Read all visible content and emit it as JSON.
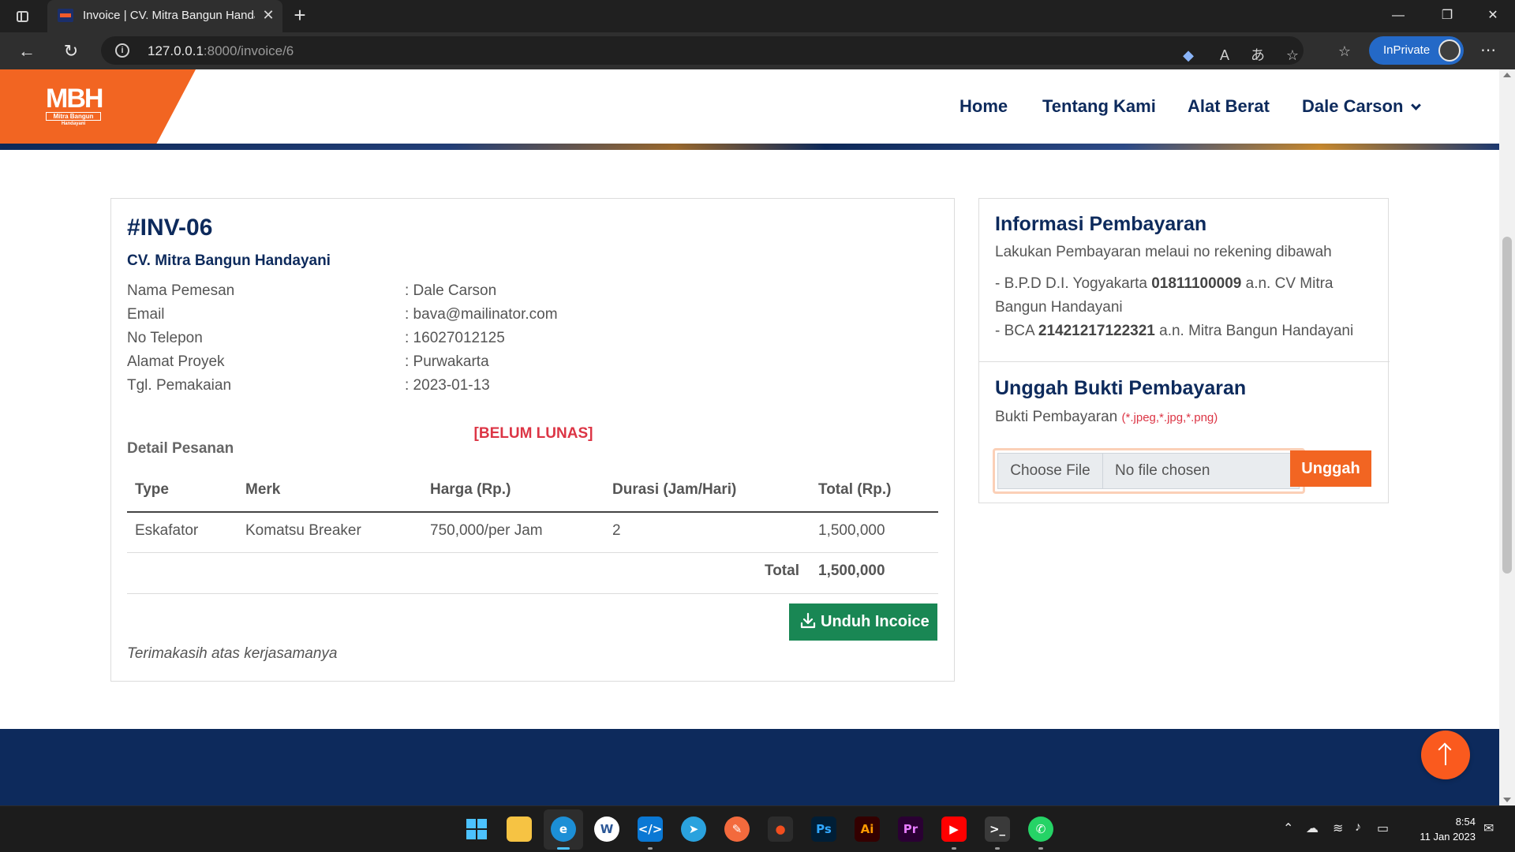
{
  "browser": {
    "tab_title": "Invoice | CV. Mitra Bangun Handayani",
    "url_host": "127.0.0.1",
    "url_path": ":8000/invoice/6",
    "inprivate_label": "InPrivate"
  },
  "navbar": {
    "logo_text": "MBH",
    "logo_tag": "Mitra Bangun",
    "logo_sub": "Handayani",
    "menu": [
      "Home",
      "Tentang Kami",
      "Alat Berat"
    ],
    "user_menu": "Dale Carson"
  },
  "invoice": {
    "number": "#INV-06",
    "company": "CV. Mitra Bangun Handayani",
    "fields": [
      {
        "label": "Nama Pemesan",
        "value": ": Dale Carson"
      },
      {
        "label": "Email",
        "value": ": bava@mailinator.com"
      },
      {
        "label": "No Telepon",
        "value": ": 16027012125"
      },
      {
        "label": "Alamat Proyek",
        "value": ": Purwakarta"
      },
      {
        "label": "Tgl. Pemakaian",
        "value": ": 2023-01-13"
      }
    ],
    "status": "[BELUM LUNAS]",
    "detail_heading": "Detail Pesanan",
    "table": {
      "headers": [
        "Type",
        "Merk",
        "Harga (Rp.)",
        "Durasi (Jam/Hari)",
        "Total (Rp.)"
      ],
      "rows": [
        [
          "Eskafator",
          "Komatsu Breaker",
          "750,000/per Jam",
          "2",
          "1,500,000"
        ]
      ],
      "total_label": "Total",
      "total_value": "1,500,000"
    },
    "download_label": "Unduh Incoice",
    "thanks": "Terimakasih atas kerjasamanya"
  },
  "payment": {
    "heading": "Informasi Pembayaran",
    "intro": "Lakukan Pembayaran melaui no rekening dibawah",
    "bank1_prefix": "- B.P.D D.I. Yogyakarta ",
    "bank1_number": "01811100009",
    "bank1_suffix": " a.n. CV Mitra",
    "bank1_line2": "Bangun Handayani",
    "bank2_prefix": "- BCA ",
    "bank2_number": "21421217122321",
    "bank2_suffix": " a.n. Mitra Bangun Handayani",
    "upload_heading": "Unggah Bukti Pembayaran",
    "upload_label": "Bukti Pembayaran ",
    "upload_formats": "(*.jpeg,*.jpg,*.png)",
    "choose_file": "Choose File",
    "no_file": "No file chosen",
    "upload_button": "Unggah"
  },
  "taskbar": {
    "time": "8:54",
    "date": "11 Jan 2023"
  }
}
